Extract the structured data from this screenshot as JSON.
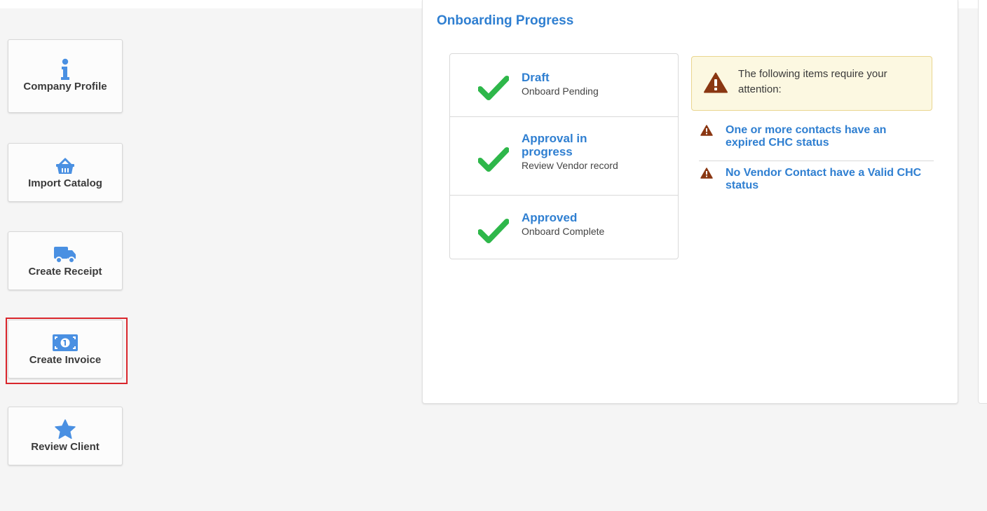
{
  "sidebar": {
    "buttons": [
      {
        "label": "Company Profile",
        "icon": "info-icon"
      },
      {
        "label": "Import Catalog",
        "icon": "basket-icon"
      },
      {
        "label": "Create Receipt",
        "icon": "truck-icon"
      },
      {
        "label": "Create Invoice",
        "icon": "money-bill-icon",
        "highlighted": true
      },
      {
        "label": "Review Client",
        "icon": "star-icon"
      }
    ]
  },
  "onboarding": {
    "title": "Onboarding Progress",
    "steps": [
      {
        "title": "Draft",
        "subtitle": "Onboard Pending",
        "status": "complete"
      },
      {
        "title": "Approval in progress",
        "subtitle": "Review Vendor record",
        "status": "complete"
      },
      {
        "title": "Approved",
        "subtitle": "Onboard Complete",
        "status": "complete"
      }
    ],
    "alert": {
      "message": "The following items require your attention:"
    },
    "issues": [
      {
        "text": "One or more contacts have an expired CHC status"
      },
      {
        "text": "No Vendor Contact have a Valid CHC status"
      }
    ]
  },
  "colors": {
    "accent_blue": "#2f7fd1",
    "icon_blue": "#4a90e2",
    "check_green": "#2eb74a",
    "warning_brown": "#8a3712",
    "alert_bg": "#fcf8e1",
    "highlight_red": "#d9262c"
  }
}
